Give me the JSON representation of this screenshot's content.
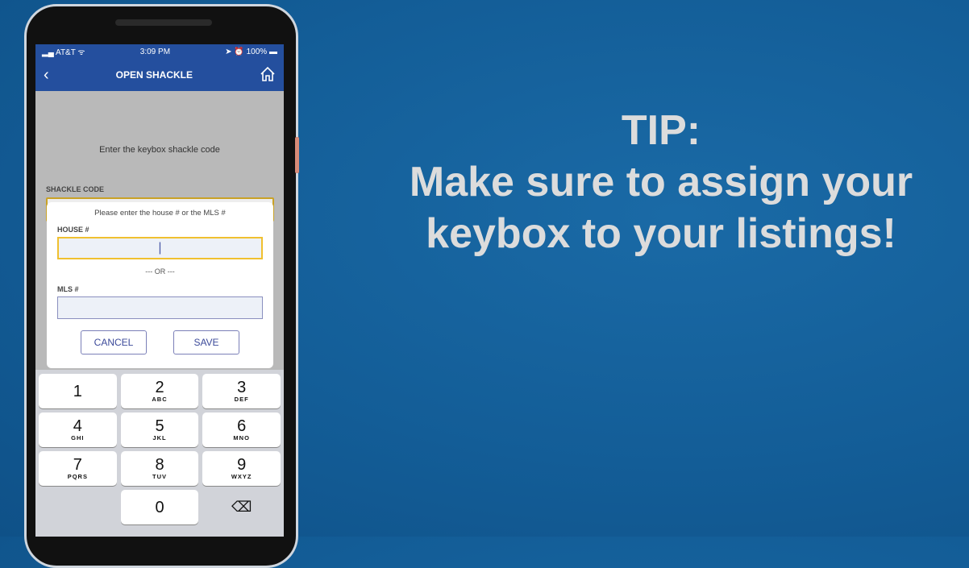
{
  "status": {
    "carrier": "AT&T",
    "time": "3:09 PM",
    "battery": "100%"
  },
  "nav": {
    "title": "OPEN SHACKLE"
  },
  "main": {
    "prompt": "Enter the keybox shackle code",
    "shackle_label": "SHACKLE CODE"
  },
  "dialog": {
    "title": "Please enter the house # or the MLS #",
    "house_label": "HOUSE #",
    "house_value": "",
    "or_text": "--- OR ---",
    "mls_label": "MLS #",
    "mls_value": "",
    "cancel": "CANCEL",
    "save": "SAVE"
  },
  "keypad": [
    {
      "n": "1",
      "l": ""
    },
    {
      "n": "2",
      "l": "ABC"
    },
    {
      "n": "3",
      "l": "DEF"
    },
    {
      "n": "4",
      "l": "GHI"
    },
    {
      "n": "5",
      "l": "JKL"
    },
    {
      "n": "6",
      "l": "MNO"
    },
    {
      "n": "7",
      "l": "PQRS"
    },
    {
      "n": "8",
      "l": "TUV"
    },
    {
      "n": "9",
      "l": "WXYZ"
    },
    {
      "n": "0",
      "l": ""
    }
  ],
  "tip": {
    "line1": "TIP:",
    "line2": "Make sure to assign your keybox to your listings!"
  }
}
